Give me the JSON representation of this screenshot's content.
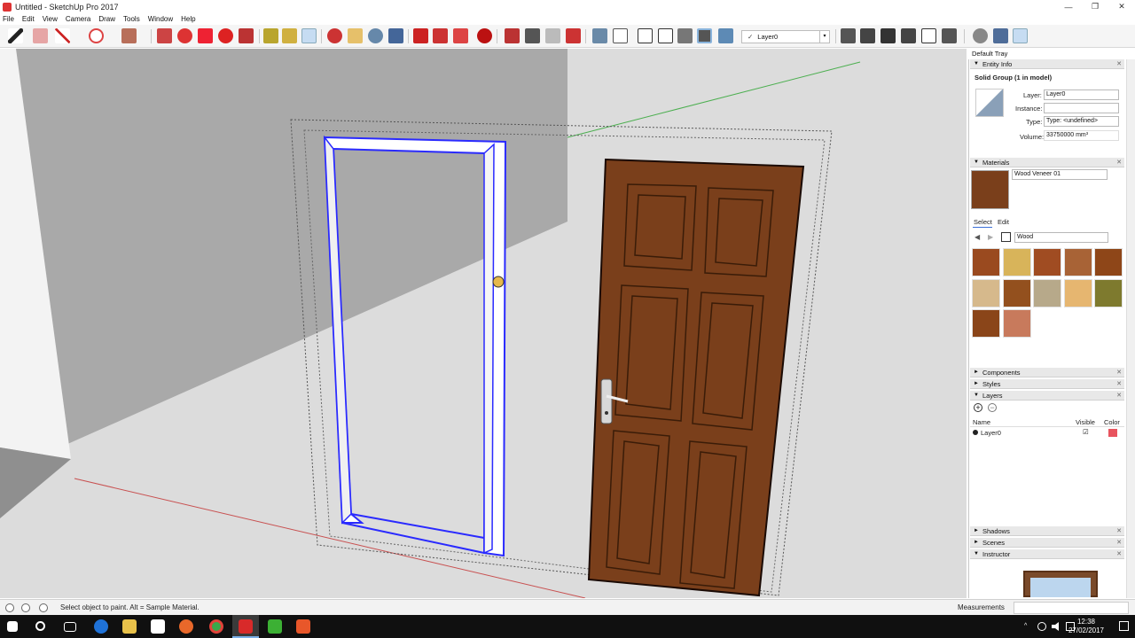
{
  "window": {
    "title": "Untitled - SketchUp Pro 2017",
    "minimize": "—",
    "restore": "❐",
    "close": "✕"
  },
  "menu": [
    "File",
    "Edit",
    "View",
    "Camera",
    "Draw",
    "Tools",
    "Window",
    "Help"
  ],
  "toolbar": {
    "layer_value": "Layer0",
    "check": "✓",
    "arrow": "▾"
  },
  "tray": {
    "title": "Default Tray",
    "entity_info": {
      "header": "Entity Info",
      "heading": "Solid Group (1 in model)",
      "layer_label": "Layer:",
      "layer_value": "Layer0",
      "instance_label": "Instance:",
      "instance_value": "",
      "type_label": "Type:",
      "type_value": "Type: <undefined>",
      "volume_label": "Volume:",
      "volume_value": "33750000 mm³"
    },
    "materials": {
      "header": "Materials",
      "current_name": "Wood Veneer 01",
      "current_color": "#7a3f1b",
      "tab_select": "Select",
      "tab_edit": "Edit",
      "collection": "Wood",
      "swatches": [
        "#9a4a1f",
        "#d8b45a",
        "#a04c22",
        "#a86336",
        "#8e4618",
        "#d6b98c",
        "#93501e",
        "#b7a98a",
        "#e6b670",
        "#7e7a2e",
        "#8a4519",
        "#c87a5c"
      ]
    },
    "components_header": "Components",
    "styles_header": "Styles",
    "layers": {
      "header": "Layers",
      "col_name": "Name",
      "col_visible": "Visible",
      "col_color": "Color",
      "rows": [
        {
          "name": "Layer0",
          "visible": "☑",
          "color": "#e8545e"
        }
      ]
    },
    "shadows_header": "Shadows",
    "scenes_header": "Scenes",
    "instructor_header": "Instructor"
  },
  "status": {
    "message": "Select object to paint. Alt = Sample Material.",
    "measurements_label": "Measurements"
  },
  "taskbar": {
    "time": "12:38",
    "date": "27/02/2017"
  },
  "icons": {
    "expand": "►",
    "collapse": "▼",
    "close_section": "✕",
    "pin": "▪"
  }
}
